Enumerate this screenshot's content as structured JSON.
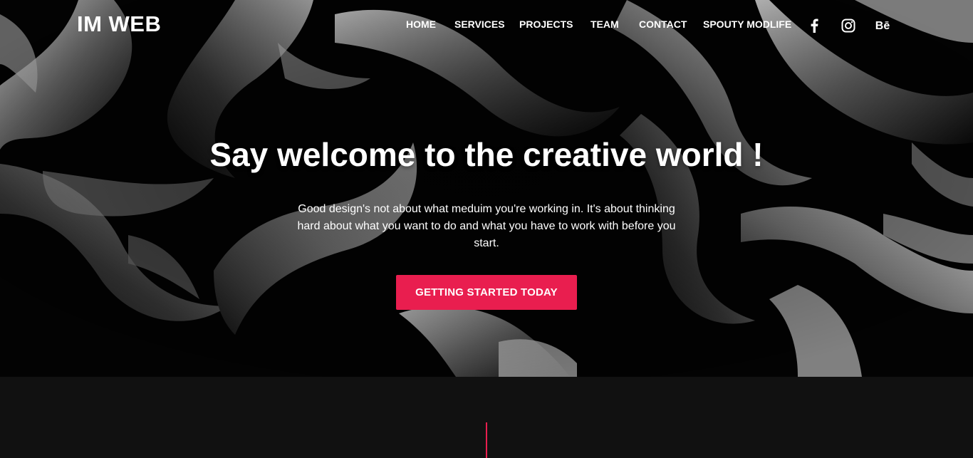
{
  "header": {
    "logo": "IM WEB",
    "nav": [
      {
        "label": "HOME"
      },
      {
        "label": "SERVICES"
      },
      {
        "label": "PROJECTS"
      },
      {
        "label": "TEAM"
      },
      {
        "label": "CONTACT"
      },
      {
        "label": "SPOUTY MODLIFE"
      }
    ],
    "social": [
      {
        "icon": "facebook-icon"
      },
      {
        "icon": "instagram-icon"
      },
      {
        "icon": "behance-icon",
        "text": "Bē"
      }
    ]
  },
  "hero": {
    "title": "Say welcome to the creative world !",
    "text": "Good design's not about what meduim you're working in. It's about thinking hard about what you want to do and what you have to work with before you start.",
    "cta_label": "GETTING STARTED TODAY"
  },
  "colors": {
    "accent": "#e91e4f",
    "background_dark": "#111111",
    "hero_bg": "#000000",
    "text": "#ffffff"
  }
}
